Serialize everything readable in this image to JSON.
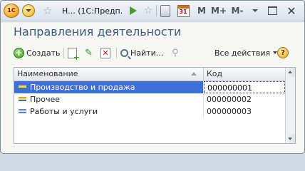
{
  "window": {
    "title": "Н...  (1С:Предп...",
    "logo_text": "1С",
    "memory_buttons": [
      "M",
      "M+",
      "M-"
    ],
    "calendar_day": "31"
  },
  "page": {
    "title": "Направления деятельности"
  },
  "toolbar": {
    "create_label": "Создать",
    "find_label": "Найти...",
    "all_actions_label": "Все действия",
    "help_label": "?"
  },
  "table": {
    "columns": [
      "Наименование",
      "Код"
    ],
    "rows": [
      {
        "name": "Производство и продажа",
        "code": "000000001",
        "selected": true
      },
      {
        "name": "Прочее",
        "code": "000000002",
        "selected": false
      },
      {
        "name": "Работы и услуги",
        "code": "000000003",
        "selected": false
      }
    ]
  },
  "colors": {
    "title_text": "#3b5a80",
    "selection": "#3f6fd8"
  }
}
